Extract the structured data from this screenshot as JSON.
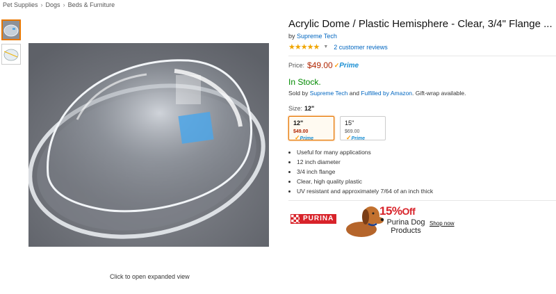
{
  "breadcrumb": [
    "Pet Supplies",
    "Dogs",
    "Beds & Furniture"
  ],
  "click_note": "Click to open expanded view",
  "product": {
    "title": "Acrylic Dome / Plastic Hemisphere - Clear, 3/4\" Flange ...",
    "by_label": "by",
    "brand": "Supreme Tech",
    "stars": "★★★★★",
    "reviews": "2 customer reviews",
    "price_label": "Price:",
    "price": "$49.00",
    "prime": "Prime",
    "stock": "In Stock.",
    "sold_by_prefix": "Sold by",
    "seller": "Supreme Tech",
    "and": "and",
    "fulfilled": "Fulfilled by Amazon",
    "gift": ". Gift-wrap available.",
    "size_label": "Size:",
    "size_value": "12\"",
    "swatches": [
      {
        "size": "12\"",
        "price": "$49.00",
        "prime": "Prime",
        "selected": true
      },
      {
        "size": "15\"",
        "price": "$69.00",
        "prime": "Prime",
        "selected": false
      }
    ],
    "bullets": [
      "Useful for many applications",
      "12 inch diameter",
      "3/4 inch flange",
      "Clear, high quality plastic",
      "UV resistant and approximately 7/64 of an inch thick"
    ]
  },
  "ad": {
    "brand": "PURINA",
    "off": "15%",
    "off_word": "Off",
    "line1": "Purina Dog",
    "line2": "Products",
    "shop": "Shop now"
  },
  "colors": {
    "accent": "#e77600",
    "link": "#0066c0",
    "price": "#b12704",
    "stock": "#008a00",
    "purina_red": "#d8232a"
  }
}
